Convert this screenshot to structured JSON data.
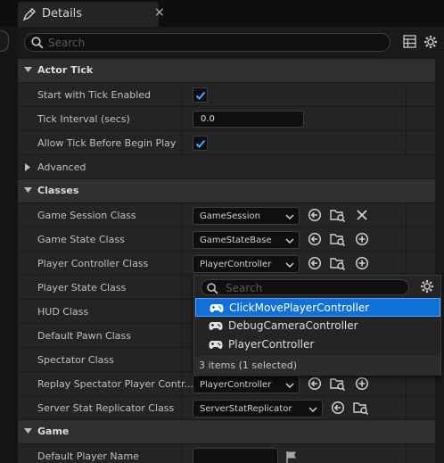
{
  "tab": {
    "title": "Details",
    "close": "×"
  },
  "search": {
    "placeholder": "Search"
  },
  "sections": {
    "actor_tick": "Actor Tick",
    "classes": "Classes",
    "game": "Game"
  },
  "actor_tick": {
    "start_with_tick": {
      "label": "Start with Tick Enabled",
      "checked": true
    },
    "tick_interval": {
      "label": "Tick Interval (secs)",
      "value": "0.0"
    },
    "allow_tick": {
      "label": "Allow Tick Before Begin Play",
      "checked": true
    },
    "advanced": "Advanced"
  },
  "classes": {
    "game_session": {
      "label": "Game Session Class",
      "value": "GameSession"
    },
    "game_state": {
      "label": "Game State Class",
      "value": "GameStateBase"
    },
    "player_controller": {
      "label": "Player Controller Class",
      "value": "PlayerController"
    },
    "player_state": {
      "label": "Player State Class"
    },
    "hud": {
      "label": "HUD Class"
    },
    "default_pawn": {
      "label": "Default Pawn Class"
    },
    "spectator": {
      "label": "Spectator Class"
    },
    "replay_spectator": {
      "label": "Replay Spectator Player Contr...",
      "value": "PlayerController"
    },
    "server_stat": {
      "label": "Server Stat Replicator Class",
      "value": "ServerStatReplicator"
    }
  },
  "game": {
    "default_player_name": {
      "label": "Default Player Name",
      "value": ""
    }
  },
  "dropdown": {
    "search_placeholder": "Search",
    "items": [
      "ClickMovePlayerController",
      "DebugCameraController",
      "PlayerController"
    ],
    "selected_index": 0,
    "status": "3 items (1 selected)"
  },
  "colors": {
    "selection": "#0f70d7",
    "panel": "#242424",
    "section": "#2f2f2f"
  }
}
